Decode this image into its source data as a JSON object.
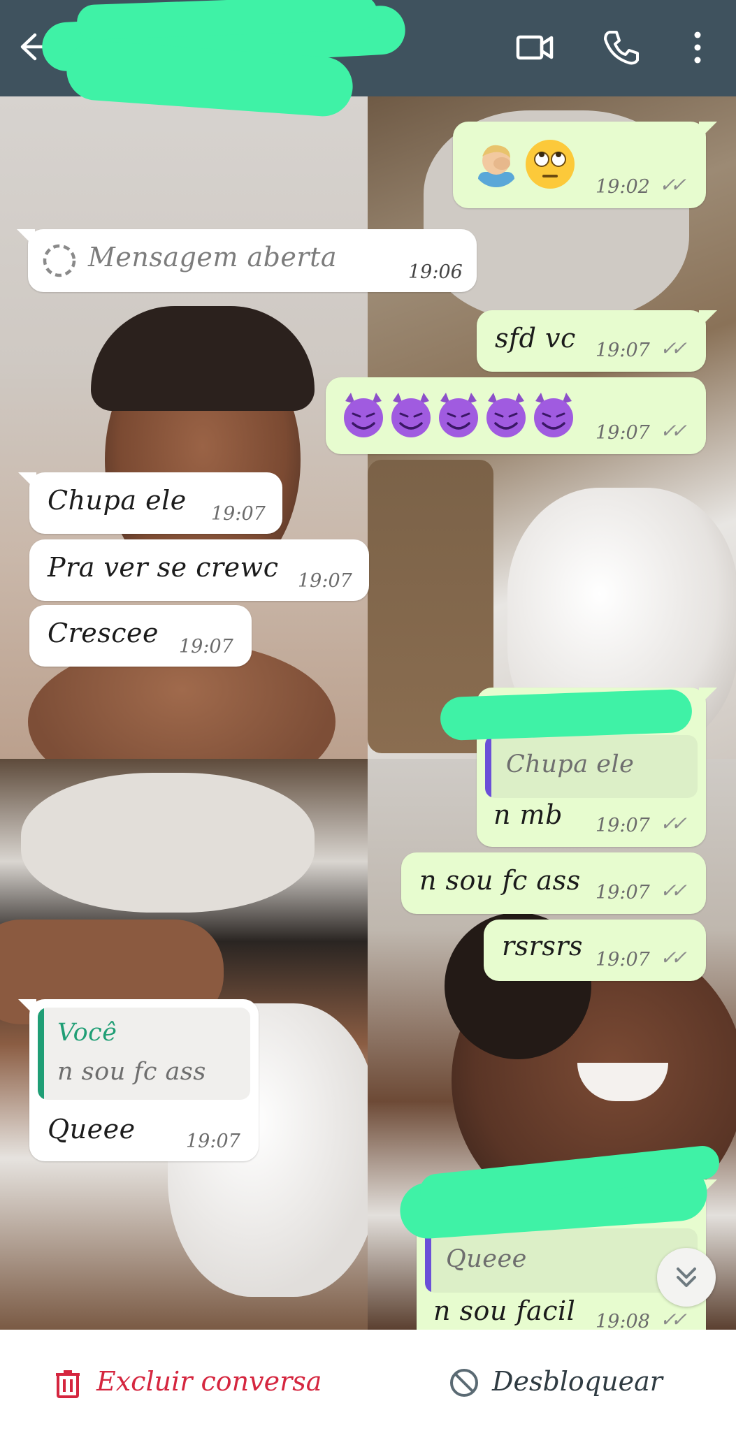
{
  "header": {
    "back_icon": "arrow-left-icon",
    "video_icon": "video-camera-icon",
    "call_icon": "phone-icon",
    "menu_icon": "more-vertical-icon"
  },
  "messages": [
    {
      "id": "m1",
      "direction": "out",
      "emoji": [
        "man-facepalming",
        "face-with-rolling-eyes"
      ],
      "time": "19:02"
    },
    {
      "id": "m2",
      "direction": "in",
      "icon": "view-once-opened-icon",
      "text": "Mensagem aberta",
      "time": "19:06"
    },
    {
      "id": "m3",
      "direction": "out",
      "text": "sfd vc",
      "time": "19:07"
    },
    {
      "id": "m4",
      "direction": "out",
      "emoji": [
        "smiling-face-with-horns",
        "smiling-face-with-horns",
        "smiling-face-with-horns",
        "smiling-face-with-horns",
        "smiling-face-with-horns"
      ],
      "time": "19:07"
    },
    {
      "id": "m5",
      "direction": "in",
      "text": "Chupa ele",
      "time": "19:07"
    },
    {
      "id": "m6",
      "direction": "in",
      "text": "Pra ver se crewc",
      "time": "19:07"
    },
    {
      "id": "m7",
      "direction": "in",
      "text": "Crescee",
      "time": "19:07"
    },
    {
      "id": "m8",
      "direction": "out",
      "quote_text": "Chupa ele",
      "text": "n mb",
      "time": "19:07"
    },
    {
      "id": "m9",
      "direction": "out",
      "text": "n sou fc ass",
      "time": "19:07"
    },
    {
      "id": "m10",
      "direction": "out",
      "text": "rsrsrs",
      "time": "19:07"
    },
    {
      "id": "m11",
      "direction": "in",
      "quote_author": "Você",
      "quote_text": "n sou fc ass",
      "text": "Queee",
      "time": "19:07"
    },
    {
      "id": "m12",
      "direction": "out",
      "quote_text": "Queee",
      "text": "n sou facil",
      "time": "19:08"
    }
  ],
  "scroll_button_icon": "double-chevron-down-icon",
  "bottom_bar": {
    "delete_icon": "trash-icon",
    "delete_label": "Excluir conversa",
    "unblock_icon": "block-icon",
    "unblock_label": "Desbloquear"
  },
  "colors": {
    "header": "#3f525e",
    "outgoing_bubble": "#e7fccf",
    "incoming_bubble": "#ffffff",
    "delete_red": "#d5263f",
    "quote_author_green": "#1f9e75",
    "quote_bar_purple": "#6b4fd8",
    "redaction_green": "#3ff2a6"
  }
}
